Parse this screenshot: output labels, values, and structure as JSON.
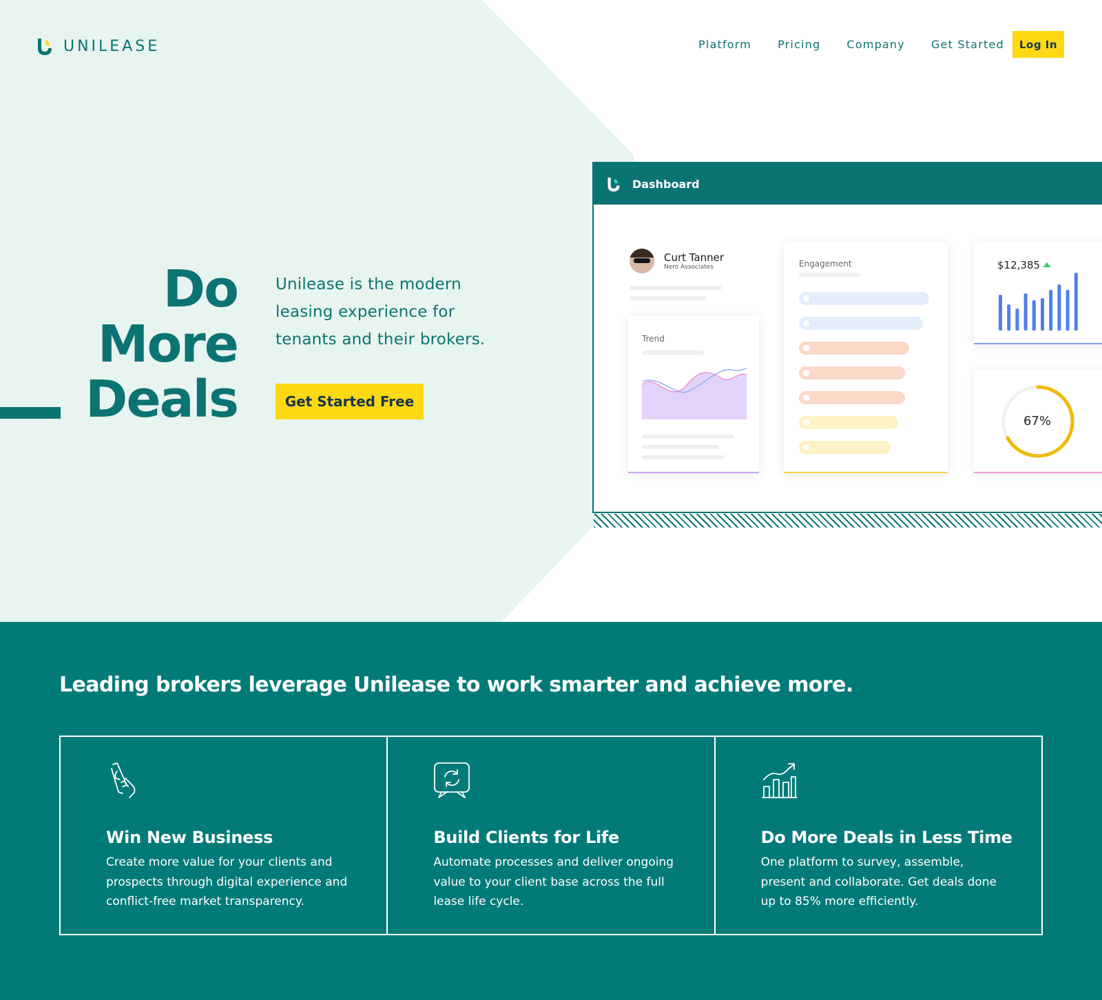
{
  "brand": {
    "name": "UNILEASE"
  },
  "nav": {
    "links": [
      "Platform",
      "Pricing",
      "Company",
      "Get Started"
    ],
    "login_label": "Log In"
  },
  "hero": {
    "headline": [
      "Do",
      "More",
      "Deals"
    ],
    "subtitle": "Unilease is the modern leasing experience for tenants and their brokers.",
    "cta_label": "Get Started Free"
  },
  "dashboard": {
    "title": "Dashboard",
    "profile": {
      "name": "Curt Tanner",
      "org": "Nero Associates"
    },
    "trend": {
      "title": "Trend"
    },
    "engagement": {
      "title": "Engagement",
      "bars": [
        {
          "level": 0.92,
          "color": "#e5eefc"
        },
        {
          "level": 0.88,
          "color": "#e5eefc"
        },
        {
          "level": 0.78,
          "color": "#fcd8c6"
        },
        {
          "level": 0.75,
          "color": "#fcd8c6"
        },
        {
          "level": 0.75,
          "color": "#fcd8c6"
        },
        {
          "level": 0.7,
          "color": "#fdf1c5"
        },
        {
          "level": 0.65,
          "color": "#fdf1c5"
        }
      ]
    },
    "stat": {
      "value": "$12,385",
      "bars": [
        0.62,
        0.45,
        0.38,
        0.64,
        0.52,
        0.56,
        0.7,
        0.8,
        0.7,
        1.0
      ]
    },
    "gauge": {
      "label": "67%",
      "value": 0.67
    }
  },
  "features": {
    "heading": "Leading brokers leverage Unilease to work smarter and achieve more.",
    "items": [
      {
        "icon": "phone-touch-icon",
        "title": "Win New Business",
        "desc": "Create more value for your clients and prospects through digital experience and conflict-free market transparency."
      },
      {
        "icon": "chat-refresh-icon",
        "title": "Build Clients for Life",
        "desc": "Automate processes and deliver ongoing value to your client base across the full lease life cycle."
      },
      {
        "icon": "growth-chart-icon",
        "title": "Do More Deals in Less Time",
        "desc": "One platform to survey, assemble, present and collaborate.  Get deals done up to 85% more efficiently."
      }
    ]
  },
  "colors": {
    "brand_teal": "#0b7472",
    "section_teal": "#027b78",
    "accent_yellow": "#fcd815",
    "hero_tint": "#e8f4f0",
    "bar_blue": "#4f7fe8",
    "gauge_yellow": "#f1b90a"
  }
}
